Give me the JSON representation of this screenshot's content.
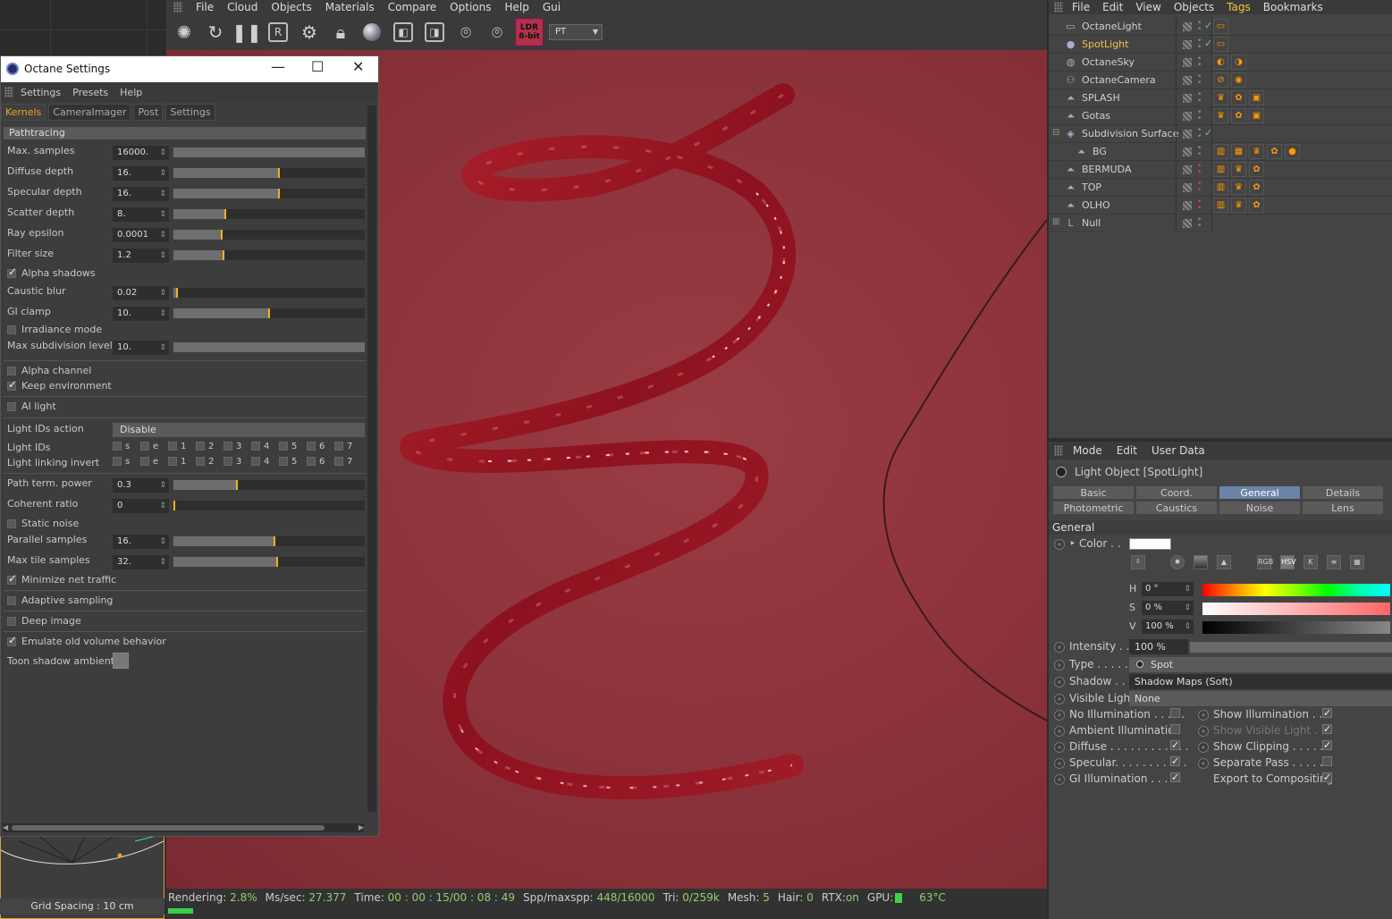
{
  "main_menu": [
    "File",
    "Cloud",
    "Objects",
    "Materials",
    "Compare",
    "Options",
    "Help",
    "Gui"
  ],
  "toolbar": {
    "icons": [
      "aperture-icon",
      "refresh-icon",
      "pause-icon",
      "region-icon",
      "gear-icon",
      "lock-icon",
      "sphere-icon",
      "picker-icon",
      "picker2-icon",
      "focus-icon",
      "material-icon"
    ],
    "ldr_label": "LDR 8-bit",
    "mode_select": "PT",
    "r_label": "R"
  },
  "octane": {
    "title": "Octane Settings",
    "menu": [
      "Settings",
      "Presets",
      "Help"
    ],
    "tabs": [
      "Kernels",
      "CameraImager",
      "Post",
      "Settings"
    ],
    "section": "Pathtracing",
    "params1": [
      {
        "label": "Max. samples",
        "value": "16000.",
        "fill": 1.0,
        "mark": null
      },
      {
        "label": "Diffuse depth",
        "value": "16.",
        "fill": 0.55,
        "mark": 0.55
      },
      {
        "label": "Specular depth",
        "value": "16.",
        "fill": 0.55,
        "mark": 0.55
      },
      {
        "label": "Scatter depth",
        "value": "8.",
        "fill": 0.27,
        "mark": 0.27
      },
      {
        "label": "Ray epsilon",
        "value": "0.0001",
        "fill": 0.25,
        "mark": 0.25
      },
      {
        "label": "Filter size",
        "value": "1.2",
        "fill": 0.26,
        "mark": 0.26
      }
    ],
    "alpha_shadows": "Alpha shadows",
    "params2": [
      {
        "label": "Caustic blur",
        "value": "0.02",
        "fill": 0.02,
        "mark": 0.02
      },
      {
        "label": "GI clamp",
        "value": "10.",
        "fill": 0.5,
        "mark": 0.5
      }
    ],
    "irradiance_mode": "Irradiance mode",
    "max_subdivision": {
      "label": "Max subdivision level",
      "value": "10."
    },
    "alpha_channel": "Alpha channel",
    "keep_environment": "Keep environment",
    "ai_light": "AI light",
    "light_ids_action": {
      "label": "Light IDs action",
      "value": "Disable"
    },
    "light_ids_label": "Light IDs",
    "light_linking_label": "Light linking invert",
    "light_id_items": [
      "s",
      "e",
      "1",
      "2",
      "3",
      "4",
      "5",
      "6",
      "7"
    ],
    "params3": [
      {
        "label": "Path term. power",
        "value": "0.3",
        "fill": 0.33,
        "mark": 0.33
      },
      {
        "label": "Coherent ratio",
        "value": "0",
        "fill": 0.0,
        "mark": 0.0
      }
    ],
    "static_noise": "Static noise",
    "params4": [
      {
        "label": "Parallel samples",
        "value": "16.",
        "fill": 0.53,
        "mark": 0.53
      },
      {
        "label": "Max tile samples",
        "value": "32.",
        "fill": 0.54,
        "mark": 0.54
      }
    ],
    "minimize_net_traffic": "Minimize net traffic",
    "adaptive_sampling": "Adaptive sampling",
    "deep_image": "Deep image",
    "emulate_old_volume": "Emulate old volume behavior",
    "toon_shadow": "Toon shadow ambient"
  },
  "grid_label": "Grid Spacing : 10 cm",
  "status": {
    "rendering_label": "Rendering:",
    "rendering": "2.8%",
    "mssec_label": "Ms/sec:",
    "mssec": "27.377",
    "time_label": "Time:",
    "time": "00 : 00 : 15/00 : 08 : 49",
    "spp_label": "Spp/maxspp:",
    "spp": "448/16000",
    "tri_label": "Tri:",
    "tri": "0/259k",
    "mesh_label": "Mesh:",
    "mesh": "5",
    "hair_label": "Hair:",
    "hair": "0",
    "rtx_label": "RTX:",
    "rtx": "on",
    "gpu_label": "GPU:",
    "temp": "63°C",
    "progress": 0.028
  },
  "objects": {
    "menu": [
      "File",
      "Edit",
      "View",
      "Objects",
      "Tags",
      "Bookmarks"
    ],
    "items": [
      {
        "name": "OctaneLight",
        "icon": "▭",
        "indent": 0,
        "check": "✓"
      },
      {
        "name": "SpotLight",
        "icon": "●",
        "indent": 0,
        "check": "✓",
        "selected": true
      },
      {
        "name": "OctaneSky",
        "icon": "◍",
        "indent": 0,
        "check": ""
      },
      {
        "name": "OctaneCamera",
        "icon": "⚇",
        "indent": 0,
        "check": ""
      },
      {
        "name": "SPLASH",
        "icon": "⏶",
        "indent": 0,
        "check": ""
      },
      {
        "name": "Gotas",
        "icon": "⏶",
        "indent": 0,
        "check": ""
      },
      {
        "name": "Subdivision Surface",
        "icon": "◈",
        "indent": 0,
        "check": "✓"
      },
      {
        "name": "BG",
        "icon": "⏶",
        "indent": 1,
        "check": ""
      },
      {
        "name": "BERMUDA",
        "icon": "⏶",
        "indent": 0,
        "check": ""
      },
      {
        "name": "TOP",
        "icon": "⏶",
        "indent": 0,
        "check": ""
      },
      {
        "name": "OLHO",
        "icon": "⏶",
        "indent": 0,
        "check": ""
      },
      {
        "name": "Null",
        "icon": "L",
        "indent": 0,
        "check": ""
      }
    ]
  },
  "attributes": {
    "menu": [
      "Mode",
      "Edit",
      "User Data"
    ],
    "header": "Light Object [SpotLight]",
    "tabs_row1": [
      "Basic",
      "Coord.",
      "General",
      "Details"
    ],
    "tabs_row2": [
      "Photometric",
      "Caustics",
      "Noise",
      "Lens"
    ],
    "active_tab": "General",
    "section": "General",
    "color_label": "Color . .",
    "color_value": "#ffffff",
    "color_modes": [
      "RGB",
      "HSV",
      "K"
    ],
    "hsv": [
      {
        "label": "H",
        "value": "0 °"
      },
      {
        "label": "S",
        "value": "0 %"
      },
      {
        "label": "V",
        "value": "100 %"
      }
    ],
    "intensity_label": "Intensity . . .",
    "intensity_value": "100 %",
    "type_label": "Type . . . . . .",
    "type_value": "Spot",
    "shadow_label": "Shadow . . .",
    "shadow_value": "Shadow Maps (Soft)",
    "visible_light_label": "Visible Light",
    "visible_light_value": "None",
    "left_checks": [
      {
        "label": "No Illumination . . . . .",
        "on": false
      },
      {
        "label": "Ambient Illumination",
        "on": false
      },
      {
        "label": "Diffuse . . . . . . . . . . . .",
        "on": true
      },
      {
        "label": "Specular. . . . . . . . . . .",
        "on": true
      },
      {
        "label": "GI Illumination . . . . .",
        "on": true
      }
    ],
    "right_checks": [
      {
        "label": "Show Illumination . . .",
        "on": true
      },
      {
        "label": "Show Visible Light . . .",
        "on": true,
        "dim": true
      },
      {
        "label": "Show Clipping . . . . . .",
        "on": true
      },
      {
        "label": "Separate Pass . . . . . .",
        "on": false
      },
      {
        "label": "Export to Compositing",
        "on": true
      }
    ]
  }
}
